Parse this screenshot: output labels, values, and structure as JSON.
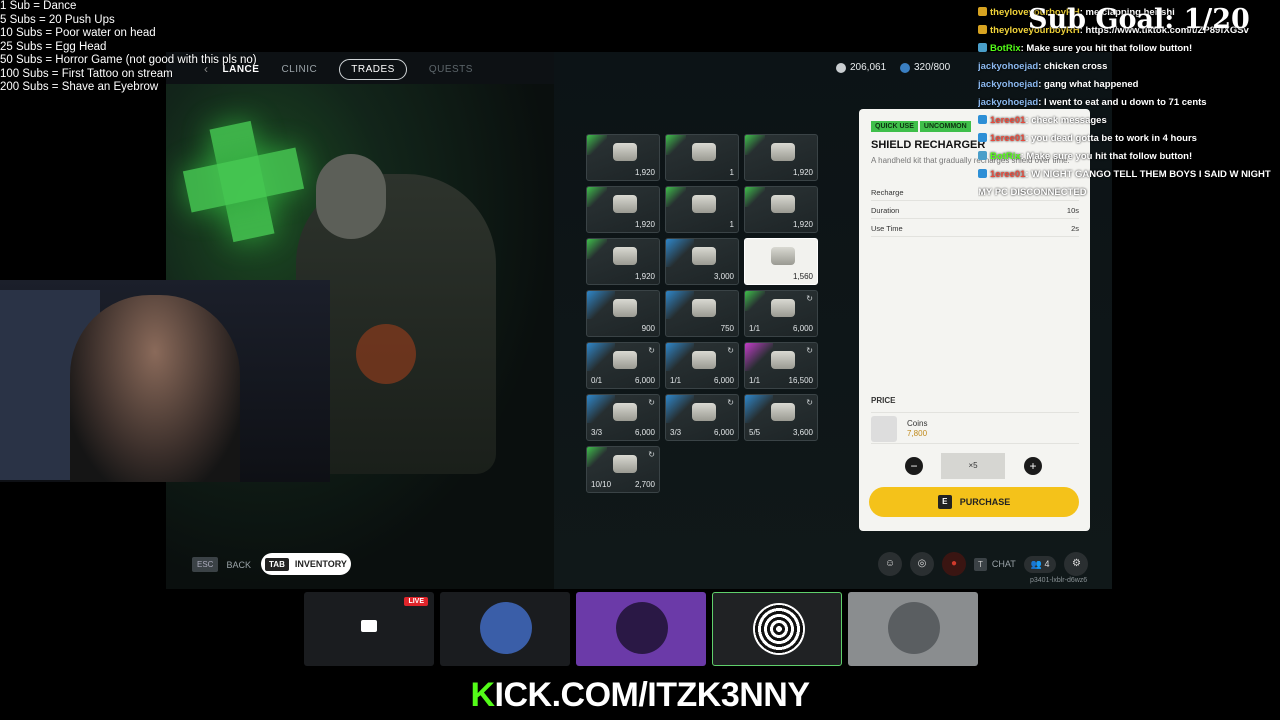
{
  "sub_goals": [
    "1 Sub = Dance",
    "5 Subs = 20 Push Ups",
    "10 Subs =  Poor water on head",
    "25 Subs = Egg Head",
    "50 Subs = Horror Game (not good with this pls no)",
    "100 Subs = First Tattoo on stream",
    "200 Subs =  Shave an Eyebrow"
  ],
  "sub_goal_counter": "Sub Goal: 1/20",
  "chat": [
    {
      "user": "theyloveyourboyRH",
      "text": ": me clapping her shi",
      "color": "#f2d43a",
      "badge": "b-gold"
    },
    {
      "user": "theyloveyourboyRH",
      "text": ": https://www.tiktok.com/t/ZP89fXGSv",
      "color": "#f2d43a",
      "badge": "b-gold"
    },
    {
      "user": "BotRix",
      "text": ": Make sure you hit that follow button!",
      "color": "#53fc18",
      "badge": "b-teal"
    },
    {
      "user": "jackyohoejad",
      "text": ": chicken cross",
      "color": "#8bb9f0",
      "badge": ""
    },
    {
      "user": "jackyohoejad",
      "text": ": gang what happened",
      "color": "#8bb9f0",
      "badge": ""
    },
    {
      "user": "jackyohoejad",
      "text": ": I went to eat and u down to 71 cents",
      "color": "#8bb9f0",
      "badge": ""
    },
    {
      "user": "1eree01",
      "text": ": check messages",
      "color": "#e84a3c",
      "badge": "b-blue"
    },
    {
      "user": "1eree01",
      "text": ": you dead gotta be to work in 4 hours",
      "color": "#e84a3c",
      "badge": "b-blue"
    },
    {
      "user": "BotRix",
      "text": ": Make sure you hit that follow button!",
      "color": "#53fc18",
      "badge": "b-teal"
    },
    {
      "user": "1eree01",
      "text": ": W NIGHT GANGO TELL THEM BOYS I SAID W NIGHT",
      "color": "#e84a3c",
      "badge": "b-blue"
    },
    {
      "user": "",
      "text": "MY PC DISCONNECTED",
      "color": "#ffffff",
      "badge": ""
    }
  ],
  "nav": {
    "back_icon": "chevron-left-icon",
    "vendor": "LANCE",
    "clinic": "CLINIC",
    "trades": "TRADES",
    "quests": "QUESTS",
    "coins": "206,061",
    "capacity": "320/800"
  },
  "grid_items": [
    {
      "rarity": "green",
      "left": "",
      "right": "1,920",
      "top": ""
    },
    {
      "rarity": "green",
      "left": "",
      "right": "1",
      "top": ""
    },
    {
      "rarity": "green",
      "left": "",
      "right": "1,920",
      "top": ""
    },
    {
      "rarity": "green",
      "left": "",
      "right": "1,920",
      "top": ""
    },
    {
      "rarity": "green",
      "left": "",
      "right": "1",
      "top": ""
    },
    {
      "rarity": "green",
      "left": "",
      "right": "1,920",
      "top": ""
    },
    {
      "rarity": "green",
      "left": "",
      "right": "1,920",
      "top": ""
    },
    {
      "rarity": "blue",
      "left": "",
      "right": "3,000",
      "top": ""
    },
    {
      "rarity": "selected",
      "left": "",
      "right": "1,560",
      "top": ""
    },
    {
      "rarity": "blue",
      "left": "",
      "right": "900",
      "top": ""
    },
    {
      "rarity": "blue",
      "left": "",
      "right": "750",
      "top": ""
    },
    {
      "rarity": "green",
      "left": "1/1",
      "right": "6,000",
      "top": "↻"
    },
    {
      "rarity": "blue",
      "left": "0/1",
      "right": "6,000",
      "top": "↻"
    },
    {
      "rarity": "blue",
      "left": "1/1",
      "right": "6,000",
      "top": "↻"
    },
    {
      "rarity": "purple",
      "left": "1/1",
      "right": "16,500",
      "top": "↻"
    },
    {
      "rarity": "blue",
      "left": "3/3",
      "right": "6,000",
      "top": "↻"
    },
    {
      "rarity": "blue",
      "left": "3/3",
      "right": "6,000",
      "top": "↻"
    },
    {
      "rarity": "blue",
      "left": "5/5",
      "right": "3,600",
      "top": "↻"
    },
    {
      "rarity": "green",
      "left": "10/10",
      "right": "2,700",
      "top": "↻"
    }
  ],
  "detail": {
    "tag1": "QUICK USE",
    "tag2": "UNCOMMON",
    "title": "SHIELD RECHARGER",
    "description": "A handheld kit that gradually recharges shield over time.",
    "stats": [
      {
        "label": "Recharge",
        "value": ""
      },
      {
        "label": "Duration",
        "value": "10s"
      },
      {
        "label": "Use Time",
        "value": "2s"
      }
    ],
    "price_label": "PRICE",
    "price_currency": "Coins",
    "price_value": "7,800",
    "quantity": "×5",
    "purchase_key": "E",
    "purchase_label": "PURCHASE"
  },
  "bottom": {
    "esc": "ESC",
    "back": "BACK",
    "tab": "TAB",
    "inventory": "INVENTORY",
    "chat_key": "T",
    "chat": "CHAT",
    "party": "4",
    "session": "p3401-lxblr-d6wz6"
  },
  "live_badge": "LIVE",
  "kick": {
    "k": "K",
    "rest": "ICK.COM/ITZK3NNY"
  }
}
